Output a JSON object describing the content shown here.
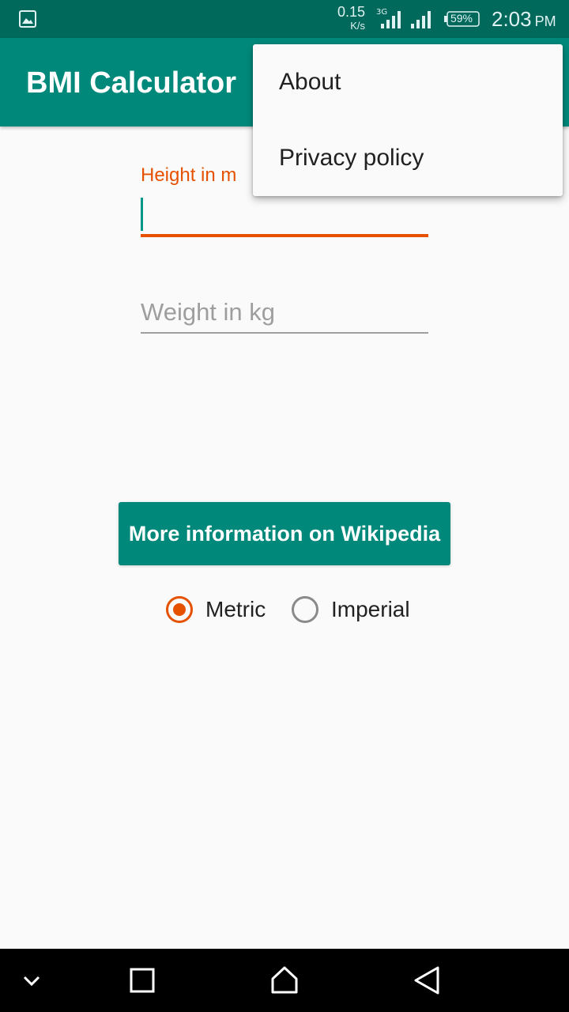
{
  "status_bar": {
    "network_speed": "0.15",
    "network_speed_unit": "K/s",
    "battery": "59%",
    "time": "2:03",
    "ampm": "PM",
    "icons": [
      "gallery-icon",
      "signal-3g-icon",
      "signal-icon",
      "battery-icon"
    ]
  },
  "app_bar": {
    "title": "BMI Calculator"
  },
  "form": {
    "height_label": "Height in m",
    "height_value": "",
    "weight_placeholder": "Weight in kg",
    "weight_value": ""
  },
  "wiki_button": {
    "label": "More information on Wikipedia"
  },
  "units": {
    "options": [
      "Metric",
      "Imperial"
    ],
    "selected": "Metric"
  },
  "overflow_menu": {
    "items": [
      "About",
      "Privacy policy"
    ]
  },
  "colors": {
    "primary": "#00897b",
    "primary_dark": "#00695c",
    "accent": "#e65100"
  },
  "nav_bar": {
    "icons": [
      "chevron-down-icon",
      "recent-apps-icon",
      "home-icon",
      "back-icon"
    ]
  }
}
